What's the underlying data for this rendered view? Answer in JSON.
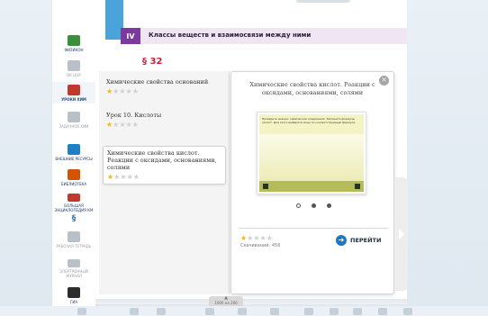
{
  "sidebar": {
    "items": [
      {
        "label": "ФИЗИКОН",
        "icon": "flask-book-icon",
        "color": "#3a8f3a",
        "disabled": false
      },
      {
        "label": "ВК ЦОР",
        "icon": "monitor-icon",
        "color": "#b8c0c8",
        "disabled": true
      },
      {
        "label": "УРОКИ ХИМ",
        "icon": "bag-icon",
        "color": "#c0392b",
        "disabled": false,
        "active": true
      },
      {
        "label": "ЗАДАЧНОЕ ХИМ",
        "icon": "molecule-icon",
        "color": "#b8c0c8",
        "disabled": true
      },
      {
        "label": "ВНЕШНИЕ РЕСУРСЫ",
        "icon": "globe-icon",
        "color": "#1f7fc4",
        "disabled": false
      },
      {
        "label": "БИБЛИОТЕКА",
        "icon": "books-icon",
        "color": "#d35400",
        "disabled": false
      },
      {
        "label": "БОЛЬШАЯ ЭНЦИКЛОПЕДИЯ КМ",
        "icon": "encyclopedia-icon",
        "color": "#c0392b",
        "disabled": false
      },
      {
        "label": "§",
        "icon": "paragraph-icon",
        "color": "#1d6fb8",
        "disabled": false,
        "paragraph": true
      },
      {
        "label": "РАБОЧАЯ ТЕТРАДЬ",
        "icon": "pencil-icon",
        "color": "#b8c0c8",
        "disabled": true
      },
      {
        "label": "ЭЛЕКТРОННЫЙ ЖУРНАЛ",
        "icon": "journal-icon",
        "color": "#b8c0c8",
        "disabled": true
      },
      {
        "label": "ГИА",
        "icon": "graduation-cap-icon",
        "color": "#2c2c2c",
        "disabled": false
      }
    ]
  },
  "page": {
    "chapter_number": "IV",
    "chapter_title": "Классы веществ и взаимосвязи между ними",
    "section": "§ 32"
  },
  "lessons": [
    {
      "title": "Химические свойства оснований",
      "rating": 1,
      "max": 5
    },
    {
      "title": "Урок 10. Кислоты",
      "rating": 1,
      "max": 5
    },
    {
      "title": "Химические свойства кислот. Реакции с оксидами, основаниями, солями",
      "rating": 1,
      "max": 5,
      "selected": true
    }
  ],
  "preview": {
    "title": "Химические свойства кислот. Реакции с оксидами, основаниями, солями",
    "thumbnail_text": "Проверьте знание: химические соединения. Запишите формулы кислот. Для этого выберите ионы по соответствующей формуле.",
    "slides": 3,
    "current_slide": 1,
    "rating": 1,
    "max_rating": 5,
    "downloads": "Скачиваний: 456",
    "go_label": "ПЕРЕЙТИ"
  },
  "zoom": {
    "label": "1000 на 200"
  },
  "colors": {
    "accent": "#1d77c1",
    "chapter": "#7d3a9e",
    "section": "#c8223b",
    "star": "#f4b81c"
  }
}
